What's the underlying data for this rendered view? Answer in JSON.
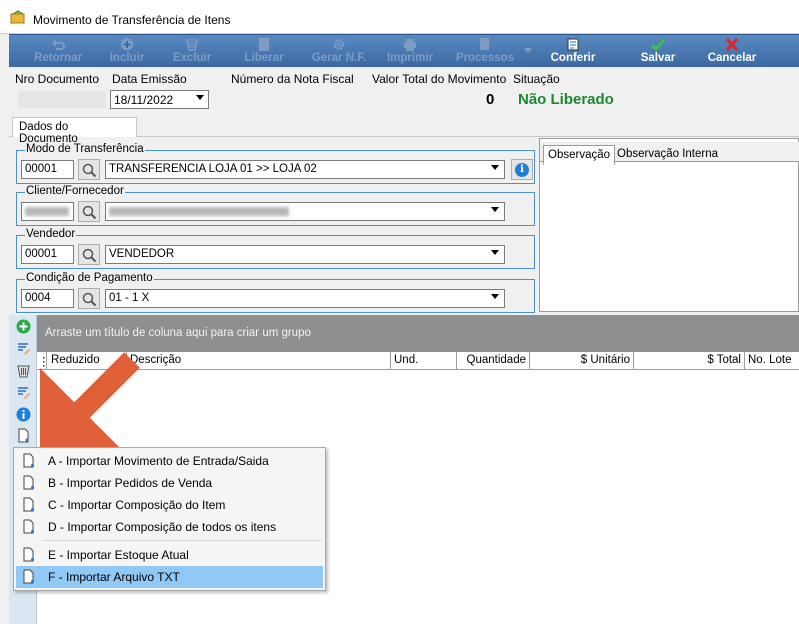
{
  "window": {
    "title": "Movimento de Transferência de Itens"
  },
  "toolbar": {
    "retornar": "Retornar",
    "incluir": "Incluir",
    "excluir": "Excluir",
    "liberar": "Liberar",
    "gerar_nf": "Gerar N.F.",
    "imprimir": "Imprimir",
    "processos": "Processos",
    "conferir": "Conferir",
    "salvar": "Salvar",
    "cancelar": "Cancelar"
  },
  "header": {
    "nro_documento_label": "Nro Documento",
    "nro_documento_value": "",
    "data_emissao_label": "Data Emissão",
    "data_emissao_value": "18/11/2022",
    "nota_fiscal_label": "Número da Nota Fiscal",
    "valor_total_label": "Valor Total do Movimento",
    "situacao_label": "Situação",
    "valor_total_value": "0",
    "situacao_value": "Não Liberado",
    "situacao_color": "#1b8a2f"
  },
  "tabs": {
    "dados_documento": "Dados do Documento"
  },
  "modo": {
    "legend": "Modo de Transferência",
    "code": "00001",
    "value": "TRANSFERENCIA LOJA 01 >> LOJA 02"
  },
  "cliente": {
    "legend": "Cliente/Fornecedor"
  },
  "vendedor": {
    "legend": "Vendedor",
    "code": "00001",
    "value": "VENDEDOR"
  },
  "pagamento": {
    "legend": "Condição de Pagamento",
    "code": "0004",
    "value": "01 - 1 X"
  },
  "observacao": {
    "tab_obs": "Observação",
    "tab_interna": "Observação Interna"
  },
  "grid": {
    "group_hint": "Arraste um título de coluna aqui para criar um grupo",
    "columns": [
      "Reduzido",
      "Descrição",
      "Und.",
      "Quantidade",
      "$ Unitário",
      "$ Total",
      "No. Lote"
    ]
  },
  "menu": {
    "items": [
      "A - Importar Movimento de Entrada/Saida",
      "B - Importar Pedidos de Venda",
      "C - Importar Composição do Item",
      "D - Importar Composição de todos os itens",
      "E - Importar Estoque Atual",
      "F - Importar Arquivo TXT"
    ],
    "selected_index": 5
  },
  "colors": {
    "toolbar": "#4a78b0",
    "highlight": "#90c8f6",
    "arrow": "#e0603a"
  }
}
